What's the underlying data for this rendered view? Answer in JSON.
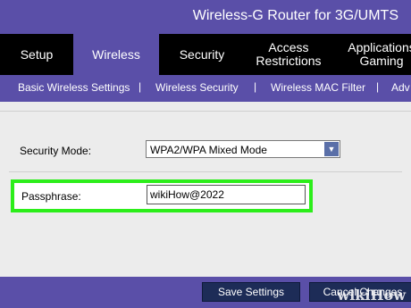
{
  "header": {
    "product_name": "Wireless-G Router for 3G/UMTS"
  },
  "nav": {
    "tabs": [
      {
        "label": "Setup",
        "active": false
      },
      {
        "label": "Wireless",
        "active": true
      },
      {
        "label": "Security",
        "active": false
      },
      {
        "label": "Access\nRestrictions",
        "active": false
      },
      {
        "label": "Applications\nGaming",
        "active": false
      }
    ]
  },
  "subnav": {
    "items": [
      "Basic Wireless Settings",
      "Wireless Security",
      "Wireless MAC Filter",
      "Adv"
    ],
    "separator": "|"
  },
  "form": {
    "security_mode_label": "Security Mode:",
    "security_mode_value": "WPA2/WPA Mixed Mode",
    "passphrase_label": "Passphrase:",
    "passphrase_value": "wikiHow@2022"
  },
  "footer": {
    "save_label": "Save Settings",
    "cancel_label": "Cancel Changes"
  },
  "watermark": "wikiHow",
  "colors": {
    "brand": "#5a4fa8",
    "nav": "#000000",
    "highlight": "#2cee1a",
    "button": "#1d2c57"
  }
}
